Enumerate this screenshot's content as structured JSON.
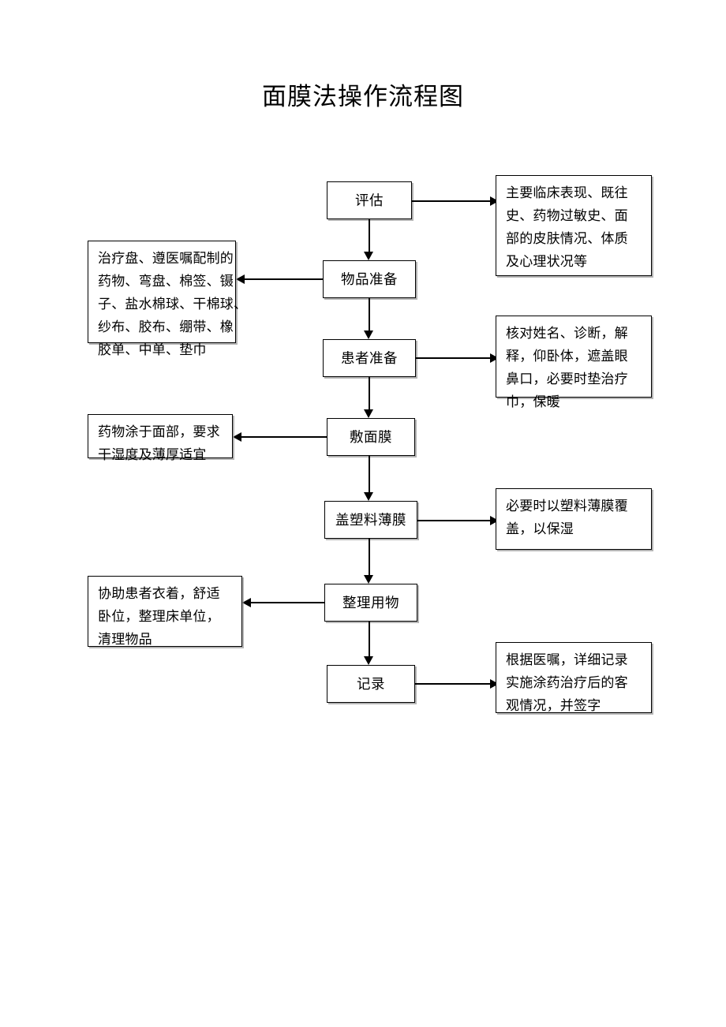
{
  "document": {
    "title": "面膜法操作流程图"
  },
  "flow": {
    "nodes": [
      {
        "id": "assess",
        "label": "评估"
      },
      {
        "id": "item-prep",
        "label": "物品准备"
      },
      {
        "id": "patient-prep",
        "label": "患者准备"
      },
      {
        "id": "apply-mask",
        "label": "敷面膜"
      },
      {
        "id": "cover-film",
        "label": "盖塑料薄膜"
      },
      {
        "id": "tidy-items",
        "label": "整理用物"
      },
      {
        "id": "record",
        "label": "记录"
      }
    ],
    "notes": [
      {
        "id": "assess-note",
        "side": "right",
        "for": "评估",
        "lines": [
          "主要临床表现、既往",
          "史、药物过敏史、面",
          "部的皮肤情况、体质",
          "及心理状况等"
        ]
      },
      {
        "id": "item-prep-note",
        "side": "left",
        "for": "物品准备",
        "lines": [
          "治疗盘、遵医嘱配制的",
          "药物、弯盘、棉签、镊",
          "子、盐水棉球、干棉球、",
          "纱布、胶布、绷带、橡",
          "胶单、中单、垫巾"
        ]
      },
      {
        "id": "patient-prep-note",
        "side": "right",
        "for": "患者准备",
        "lines": [
          "核对姓名、诊断，解",
          "释，仰卧体，遮盖眼",
          "鼻口，必要时垫治疗",
          "巾，保暖"
        ]
      },
      {
        "id": "apply-mask-note",
        "side": "left",
        "for": "敷面膜",
        "lines": [
          "药物涂于面部，要求",
          "干湿度及薄厚适宜"
        ]
      },
      {
        "id": "cover-film-note",
        "side": "right",
        "for": "盖塑料薄膜",
        "lines": [
          "必要时以塑料薄膜覆",
          "盖，以保湿"
        ]
      },
      {
        "id": "tidy-items-note",
        "side": "left",
        "for": "整理用物",
        "lines": [
          "协助患者衣着，舒适",
          "卧位，整理床单位，",
          "清理物品"
        ]
      },
      {
        "id": "record-note",
        "side": "right",
        "for": "记录",
        "lines": [
          "根据医嘱，详细记录",
          "实施涂药治疗后的客",
          "观情况，并签字"
        ]
      }
    ]
  },
  "colors": {
    "stroke": "#000000",
    "background": "#ffffff",
    "shadow": "#787878"
  }
}
